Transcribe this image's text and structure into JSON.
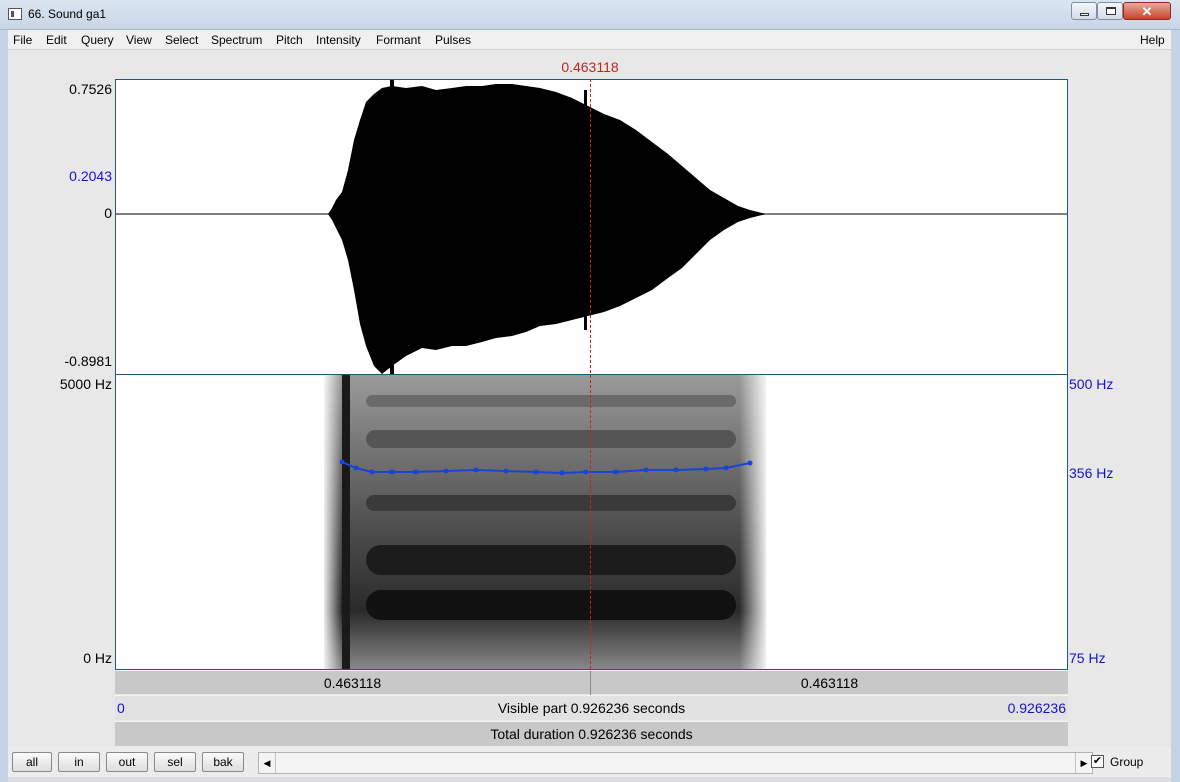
{
  "window": {
    "title": "66. Sound ga1"
  },
  "menu": [
    "File",
    "Edit",
    "Query",
    "View",
    "Select",
    "Spectrum",
    "Pitch",
    "Intensity",
    "Formant",
    "Pulses"
  ],
  "help_label": "Help",
  "cursor": {
    "time_label": "0.463118",
    "time_seconds": 0.463118
  },
  "waveform": {
    "ymax_label": "0.7526",
    "ymid_label": "0.2043",
    "zero_label": "0",
    "ymin_label": "-0.8981"
  },
  "spectrogram": {
    "top_label": "5000 Hz",
    "bottom_label": "0 Hz"
  },
  "pitch": {
    "top_label": "500 Hz",
    "value_label": "356 Hz",
    "bottom_label": "75 Hz"
  },
  "timebar": {
    "left_segment": "0.463118",
    "right_segment": "0.463118",
    "start": "0",
    "end": "0.926236",
    "visible_part": "Visible part 0.926236 seconds",
    "total_duration": "Total duration 0.926236 seconds"
  },
  "buttons": {
    "all": "all",
    "in": "in",
    "out": "out",
    "sel": "sel",
    "bak": "bak"
  },
  "group": {
    "label": "Group",
    "checked": true,
    "check_mark": "✔"
  },
  "colors": {
    "cursor": "#c4241c",
    "pitch": "#1a43d8",
    "axis_blue": "#1515c8",
    "panel_border": "#1e5a78"
  },
  "icons": [
    "window-icon",
    "minimize-icon",
    "maximize-icon",
    "close-icon",
    "scroll-left-icon",
    "scroll-right-icon",
    "checkbox-icon"
  ]
}
